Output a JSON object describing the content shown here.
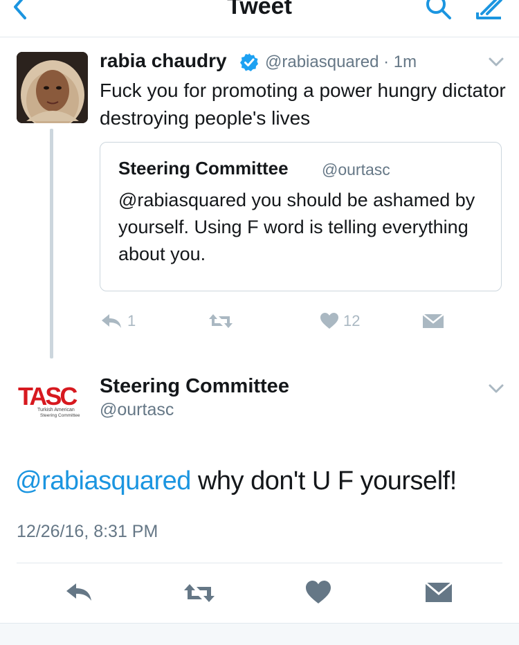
{
  "header": {
    "title": "Tweet"
  },
  "original_tweet": {
    "author_name": "rabia chaudry",
    "handle": "@rabiasquared",
    "time": " · 1m",
    "text": "Fuck you for promoting a power hungry dictator destroying people's lives",
    "quoted": {
      "author_name": "Steering Committee",
      "handle": "@ourtasc",
      "text": "@rabiasquared you should be ashamed by yourself. Using F word is telling everything about you."
    },
    "actions": {
      "reply_count": "1",
      "like_count": "12"
    }
  },
  "main_tweet": {
    "logo_text": "TASC",
    "logo_subtext_1": "Turkish American",
    "logo_subtext_2": "Steering Committee",
    "author_name": "Steering Committee",
    "handle": "@ourtasc",
    "mention": "@rabiasquared",
    "text": " why don't U F yourself!",
    "timestamp": "12/26/16, 8:31 PM"
  },
  "colors": {
    "accent": "#1b95e0",
    "secondary_text": "#657786",
    "icon_gray": "#aab8c2",
    "logo_red": "#d7191f"
  }
}
